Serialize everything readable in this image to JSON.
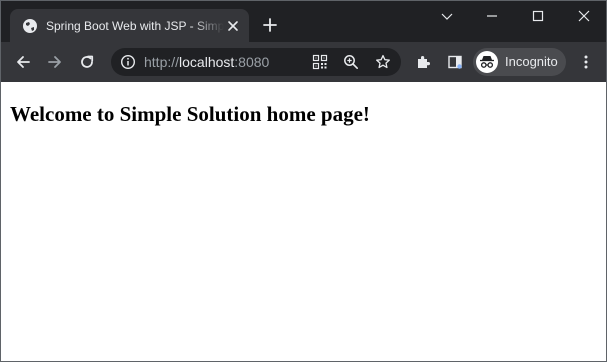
{
  "browser": {
    "tab": {
      "title": "Spring Boot Web with JSP - Simple Solution",
      "favicon": "globe-icon"
    },
    "address_bar": {
      "scheme": "http://",
      "host": "localhost",
      "port": ":8080"
    },
    "profile": {
      "label": "Incognito",
      "icon": "incognito-icon"
    },
    "colors": {
      "frame": "#202124",
      "toolbar": "#35363a",
      "text": "#e8eaed",
      "muted_text": "#9aa0a6"
    }
  },
  "page": {
    "heading": "Welcome to Simple Solution home page!"
  }
}
